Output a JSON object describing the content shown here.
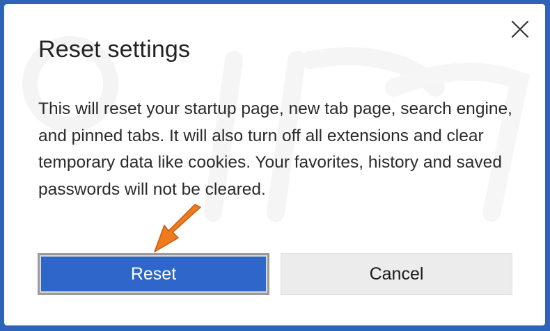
{
  "dialog": {
    "title": "Reset settings",
    "message": "This will reset your startup page, new tab page, search engine, and pinned tabs. It will also turn off all extensions and clear temporary data like cookies. Your favorites, history and saved passwords will not be cleared.",
    "close_icon": "close-icon",
    "buttons": {
      "reset_label": "Reset",
      "cancel_label": "Cancel"
    }
  },
  "colors": {
    "frame": "#2f63b8",
    "primary_button": "#2f66c9",
    "secondary_button": "#ececec",
    "annotation_arrow": "#f07a1e"
  }
}
